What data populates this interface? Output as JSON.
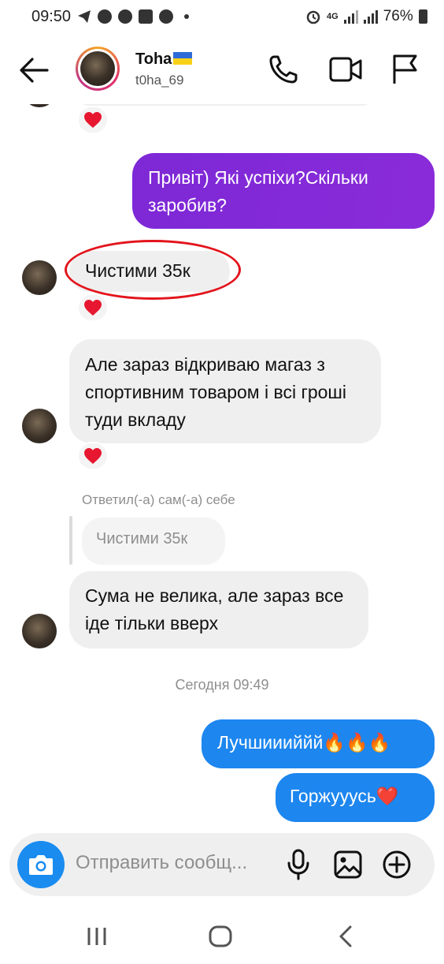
{
  "status_bar": {
    "time": "09:50",
    "network": "4G",
    "battery": "76%"
  },
  "header": {
    "name": "Toha",
    "username": "t0ha_69",
    "icons": [
      "back-arrow-icon",
      "phone-icon",
      "video-camera-icon",
      "flag-icon"
    ]
  },
  "messages": [
    {
      "side": "out",
      "text": "Привіт) Які успіхи?Скільки заробив?"
    },
    {
      "side": "in",
      "text": "Чистими 35к",
      "reaction": "heart"
    },
    {
      "side": "in",
      "text": "Але зараз відкриваю магаз з спортивним товаром і всі гроші туди вкладу",
      "reaction": "heart"
    },
    {
      "side": "in",
      "reply_meta": "Ответил(-а) сам(-а) себе",
      "reply_quote": "Чистими 35к",
      "text": "Сума не велика, але зараз все іде тільки вверх"
    },
    {
      "side": "out",
      "text": "Лучшиииййй🔥🔥🔥"
    },
    {
      "side": "out",
      "text": "Горжууусь❤️"
    }
  ],
  "separator": "Сегодня 09:49",
  "composer": {
    "placeholder": "Отправить сообщ..."
  },
  "colors": {
    "purple_bubble": "#8a2bd9",
    "blue_bubble": "#1d86ef",
    "incoming_bubble": "#efefef",
    "highlight_ellipse": "#e3141c",
    "heart": "#e6172f"
  }
}
